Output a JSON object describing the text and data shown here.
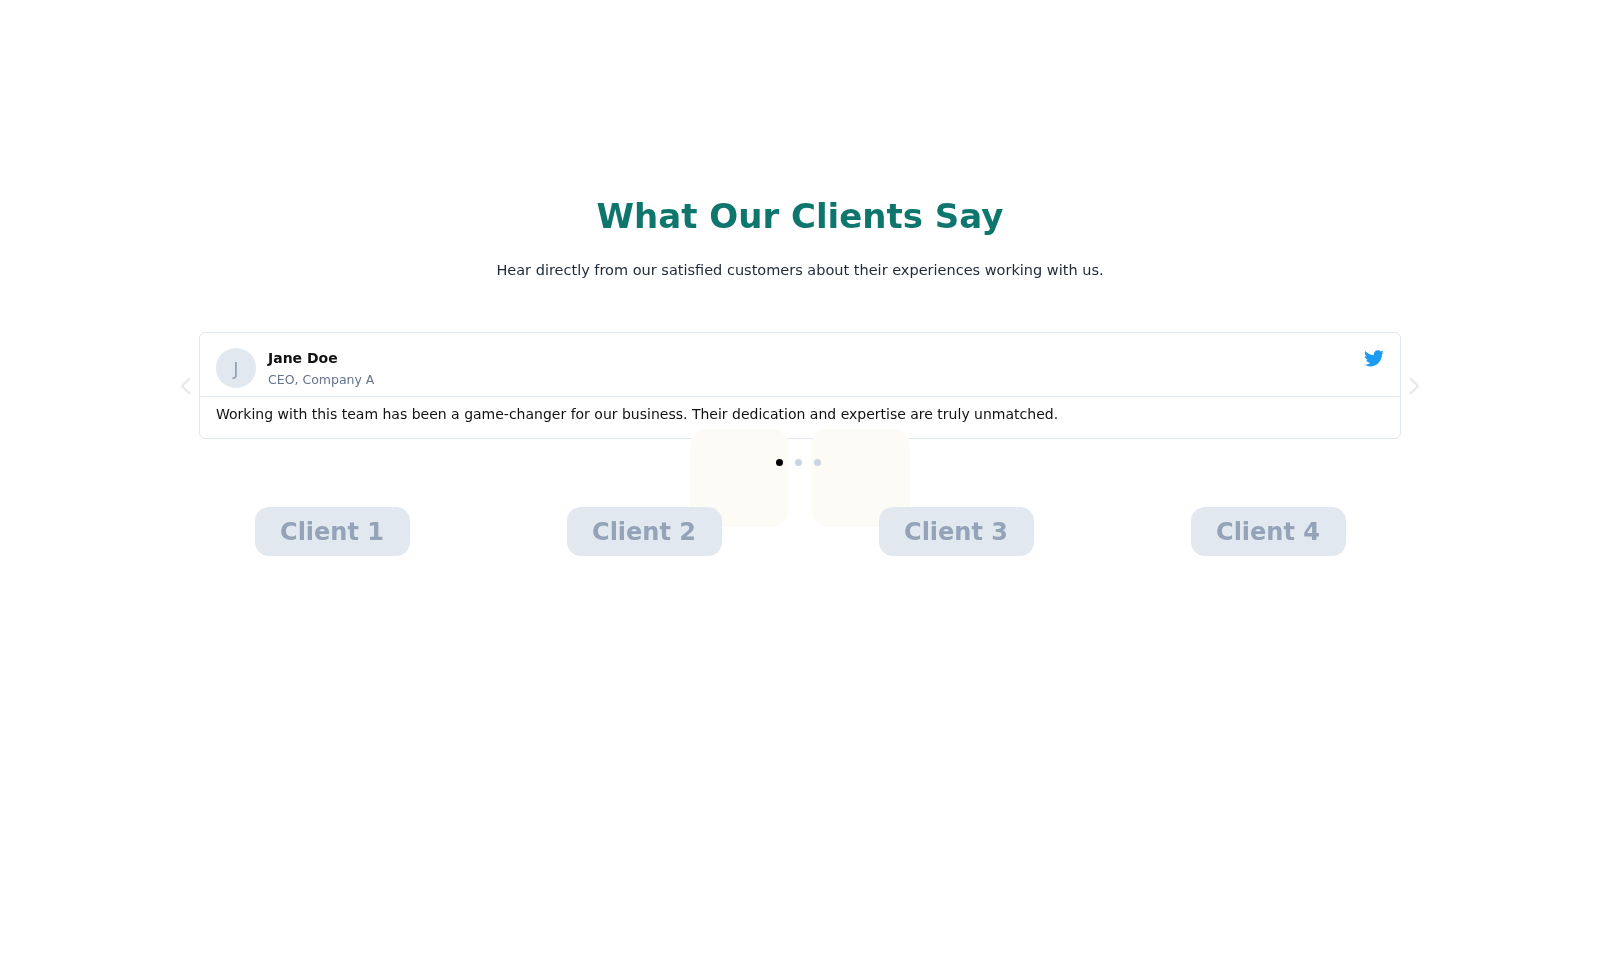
{
  "heading": "What Our Clients Say",
  "subheading": "Hear directly from our satisfied customers about their experiences working with us.",
  "testimonial": {
    "avatar_initial": "J",
    "name": "Jane Doe",
    "role": "CEO, Company A",
    "quote": "Working with this team has been a game-changer for our business. Their dedication and expertise are truly unmatched."
  },
  "pagination": [
    {
      "selected": true
    },
    {
      "selected": false
    },
    {
      "selected": false
    }
  ],
  "clients": [
    "Client 1",
    "Client 2",
    "Client 3",
    "Client 4"
  ]
}
